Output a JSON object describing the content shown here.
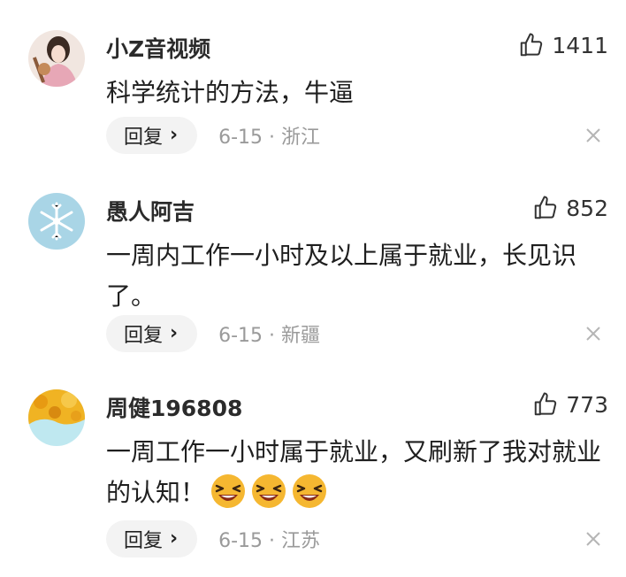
{
  "comments": [
    {
      "username": "小Z音视频",
      "likes": "1411",
      "text": "科学统计的方法，牛逼",
      "reply_label": "回复",
      "date": "6-15",
      "location": "浙江",
      "separator": "·"
    },
    {
      "username": "愚人阿吉",
      "likes": "852",
      "text": "一周内工作一小时及以上属于就业，长见识了。",
      "reply_label": "回复",
      "date": "6-15",
      "location": "新疆",
      "separator": "·"
    },
    {
      "username": "周健196808",
      "likes": "773",
      "text": "一周工作一小时属于就业，又刷新了我对就业的认知！",
      "reply_label": "回复",
      "date": "6-15",
      "location": "江苏",
      "separator": "·",
      "emoji": [
        "laughing-face",
        "laughing-face",
        "laughing-face"
      ]
    }
  ],
  "icons": {
    "like": "thumbs-up-icon",
    "close": "close-icon",
    "chevron": "chevron-right-icon",
    "chevron_glyph": "›"
  },
  "colors": {
    "text": "#1f1f1f",
    "meta": "#9a9a9a",
    "reply_bg": "#f3f3f3"
  }
}
